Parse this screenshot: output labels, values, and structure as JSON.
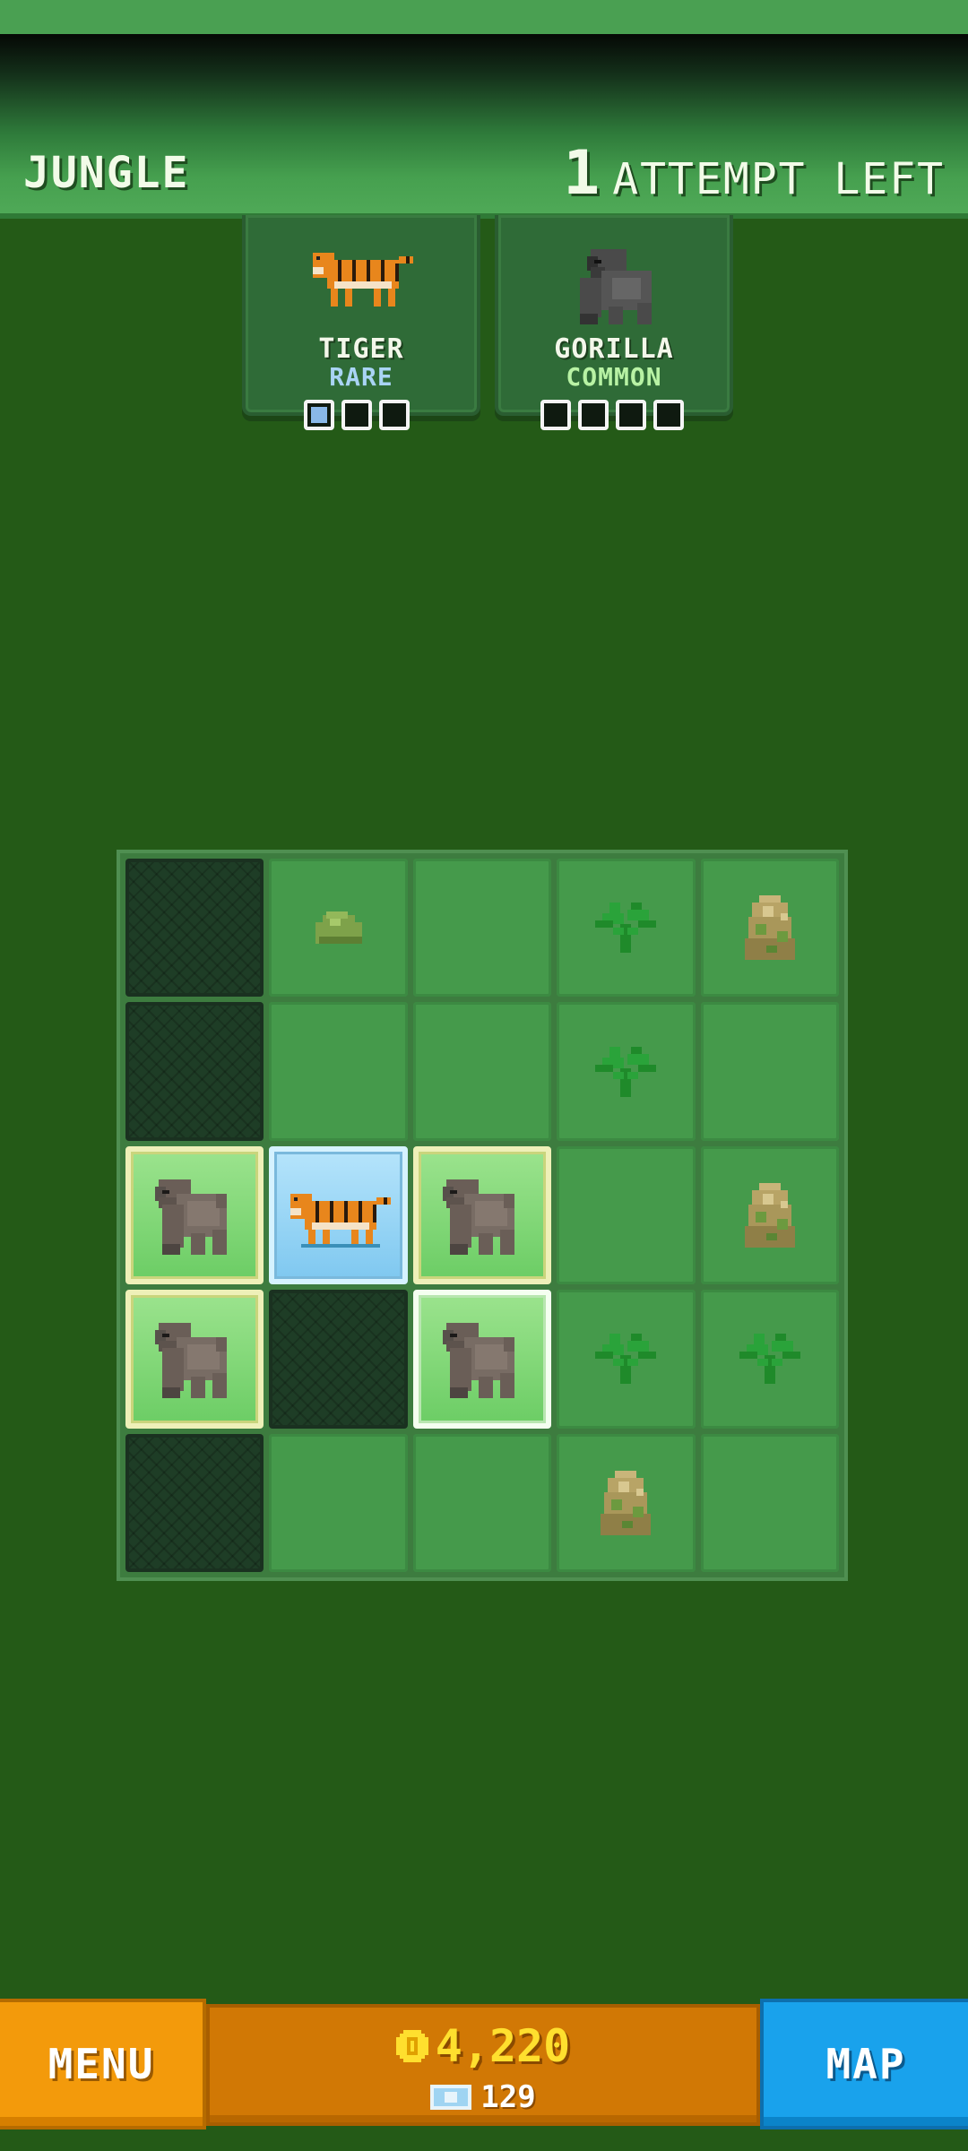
{
  "header": {
    "area_name": "JUNGLE",
    "attempts_count": "1",
    "attempts_label": "ATTEMPT LEFT"
  },
  "animals": [
    {
      "name": "TIGER",
      "rarity": "RARE",
      "found": 1,
      "total": 3
    },
    {
      "name": "GORILLA",
      "rarity": "COMMON",
      "found": 0,
      "total": 4
    }
  ],
  "board": {
    "rows": [
      [
        "dark",
        "rock",
        "grass",
        "plant",
        "boulder"
      ],
      [
        "dark",
        "grass",
        "grass",
        "plant",
        "grass"
      ],
      [
        "gorilla",
        "tiger",
        "gorilla",
        "grass",
        "boulder"
      ],
      [
        "gorilla",
        "dark",
        "gorilla-selected",
        "plant",
        "plant"
      ],
      [
        "dark",
        "grass",
        "grass",
        "boulder",
        "grass"
      ]
    ]
  },
  "footer": {
    "menu_label": "MENU",
    "coins": "4,220",
    "gems": "129",
    "map_label": "MAP"
  },
  "colors": {
    "background": "#245a17",
    "grass_tile": "#459a4b",
    "gorilla_tile": "#7bd46f",
    "tiger_tile": "#8fd0f3",
    "menu_button": "#f39a0b",
    "map_button": "#19a2ec",
    "coin_text": "#ffdf2e"
  }
}
